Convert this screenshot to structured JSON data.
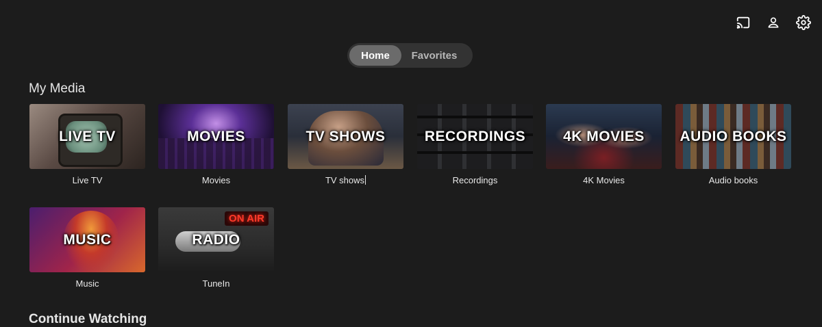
{
  "header": {
    "icons": [
      "cast-icon",
      "user-icon",
      "gear-icon"
    ]
  },
  "tabs": [
    {
      "label": "Home",
      "active": true
    },
    {
      "label": "Favorites",
      "active": false
    }
  ],
  "sections": {
    "my_media": "My Media",
    "continue_watching": "Continue Watching"
  },
  "media": [
    {
      "overlay": "LIVE TV",
      "label": "Live TV"
    },
    {
      "overlay": "MOVIES",
      "label": "Movies"
    },
    {
      "overlay": "TV SHOWS",
      "label": "TV shows"
    },
    {
      "overlay": "RECORDINGS",
      "label": "Recordings"
    },
    {
      "overlay": "4K MOVIES",
      "label": "4K Movies"
    },
    {
      "overlay": "AUDIO BOOKS",
      "label": "Audio books"
    },
    {
      "overlay": "MUSIC",
      "label": "Music"
    },
    {
      "overlay": "RADIO",
      "label": "TuneIn",
      "sign": "ON AIR"
    }
  ],
  "colors": {
    "background": "#1c1c1c",
    "tab_track": "#333333",
    "tab_active": "#6b6b6b"
  }
}
